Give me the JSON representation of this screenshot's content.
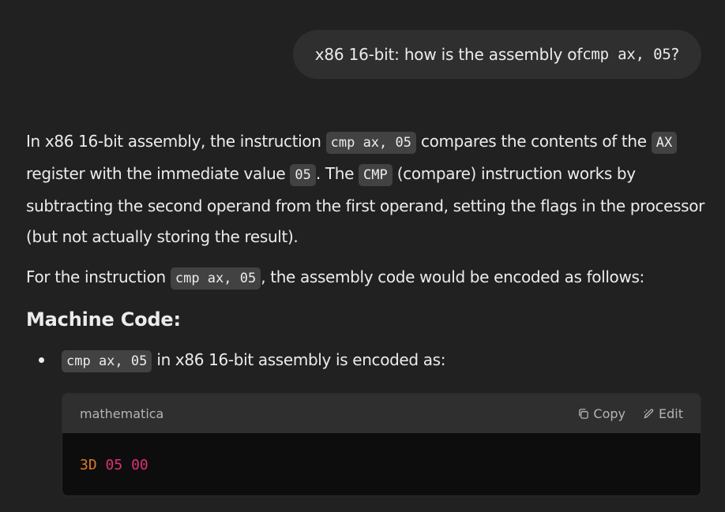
{
  "user_message": {
    "prefix": "x86 16-bit: how is the assembly of ",
    "code": "cmp ax, 05",
    "suffix": "?"
  },
  "answer": {
    "para1": {
      "t1": "In x86 16-bit assembly, the instruction ",
      "c1": "cmp ax, 05",
      "t2": " compares the contents of the ",
      "c2": "AX",
      "t3": " register with the immediate value ",
      "c3": "05",
      "t4": ". The ",
      "c4": "CMP",
      "t5": " (compare) instruction works by subtracting the second operand from the first operand, setting the flags in the processor (but not actually storing the result)."
    },
    "para2": {
      "t1": "For the instruction ",
      "c1": "cmp ax, 05",
      "t2": ", the assembly code would be encoded as follows:"
    },
    "heading": "Machine Code:",
    "bullet": {
      "code": "cmp ax, 05",
      "text": " in x86 16-bit assembly is encoded as:"
    },
    "code_block": {
      "language": "mathematica",
      "copy_label": "Copy",
      "edit_label": "Edit",
      "tokens": [
        "3D",
        "05",
        "00"
      ],
      "copy_icon": "copy-icon",
      "edit_icon": "edit-pencil-icon"
    }
  },
  "colors": {
    "background": "#212121",
    "user_bubble": "#2f2f2f",
    "inline_code_bg": "#424242",
    "code_body_bg": "#0d0d0d",
    "token_hex": "#df7a26",
    "token_number": "#df3079"
  }
}
